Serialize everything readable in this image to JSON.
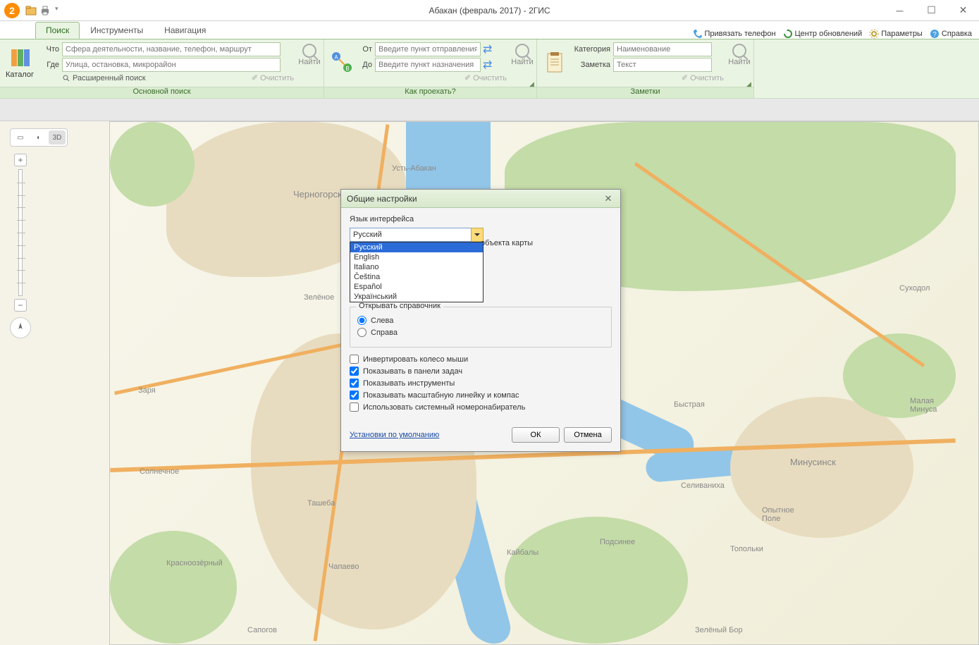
{
  "title": "Абакан (февраль 2017) - 2ГИС",
  "app_badge": "2",
  "tabs": {
    "search": "Поиск",
    "tools": "Инструменты",
    "nav": "Навигация"
  },
  "top_links": {
    "bind_phone": "Привязать телефон",
    "updates": "Центр обновлений",
    "params": "Параметры",
    "help": "Справка"
  },
  "ribbon": {
    "catalog": "Каталог",
    "what": "Что",
    "what_ph": "Сфера деятельности, название, телефон, маршрут",
    "where": "Где",
    "where_ph": "Улица, остановка, микрорайон",
    "adv_search": "Расширенный поиск",
    "clear": "Очистить",
    "find": "Найти",
    "group_main": "Основной поиск",
    "from": "От",
    "from_ph": "Введите пункт отправления",
    "to": "До",
    "to_ph": "Введите пункт назначения",
    "group_route": "Как проехать?",
    "category": "Категория",
    "category_ph": "Наименование",
    "note": "Заметка",
    "note_ph": "Текст",
    "group_notes": "Заметки"
  },
  "map_controls": {
    "mode_3d": "3D"
  },
  "map_labels": {
    "ust_abakan": "Усть-Абакан",
    "chernogorsk": "Черногорск",
    "zelenoe": "Зелёное",
    "zarya": "Заря",
    "solnechnoe": "Солнечное",
    "tasheba": "Ташеба",
    "krasnoozernyj": "Красноозёрный",
    "chapaevo": "Чапаево",
    "sapogov": "Сапогов",
    "kajbaly": "Кайбалы",
    "podsinee": "Подсинее",
    "bystraja": "Быстрая",
    "selivanikha": "Селиваниха",
    "minusinsk": "Минусинск",
    "malaya_minusa": "Малая\nМинуса",
    "opytnoe_pole": "Опытное\nПоле",
    "topolki": "Топольки",
    "sukhodol": "Суходол",
    "zelenyj_bor": "Зелёный Бор"
  },
  "dialog": {
    "title": "Общие настройки",
    "lang_legend": "Язык интерфейса",
    "lang_selected": "Русский",
    "lang_options": [
      "Русский",
      "English",
      "Italiano",
      "Čeština",
      "Español",
      "Український"
    ],
    "partial_obj": "объекта карты",
    "open_ref": "Открывать справочник",
    "left": "Слева",
    "right": "Справа",
    "invert_wheel": "Инвертировать колесо мыши",
    "show_taskbar": "Показывать в панели задач",
    "show_tools": "Показывать инструменты",
    "show_scale": "Показывать масштабную линейку и компас",
    "use_dialer": "Использовать системный номеронабиратель",
    "defaults": "Установки по умолчанию",
    "ok": "ОК",
    "cancel": "Отмена"
  }
}
